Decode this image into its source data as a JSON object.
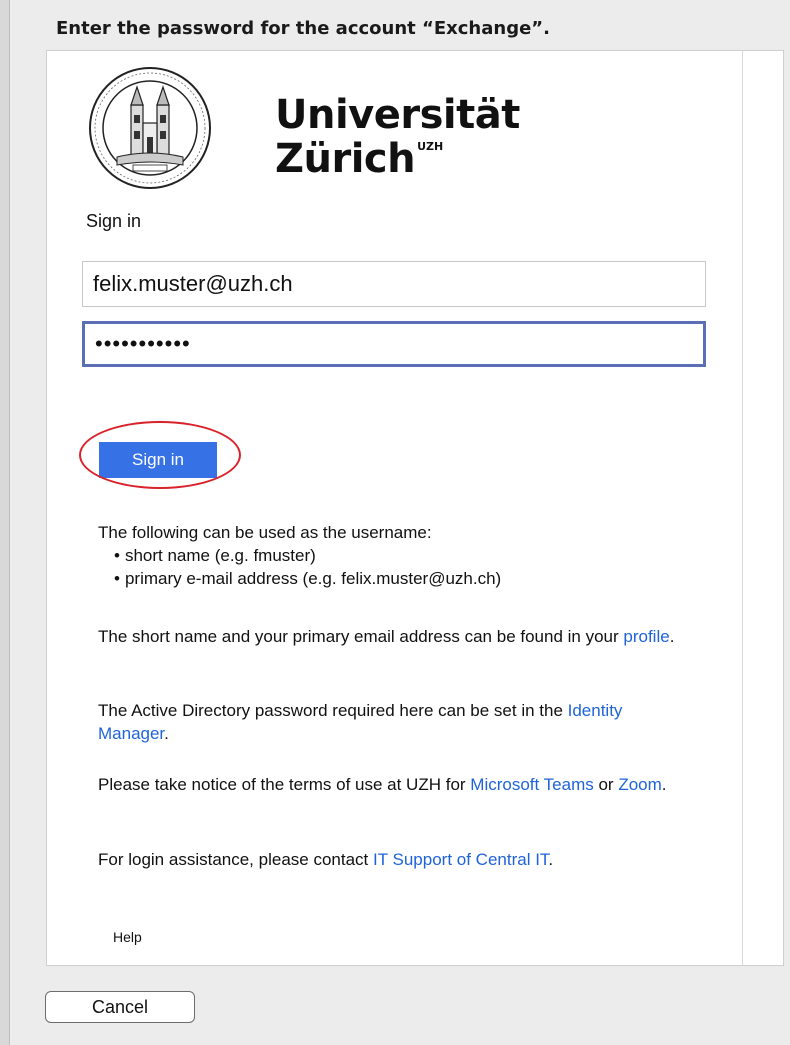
{
  "dialog": {
    "prompt": "Enter the password for the account “Exchange”.",
    "cancel_label": "Cancel"
  },
  "logo": {
    "line1": "Universität",
    "line2": "Zürich",
    "superscript": "UZH",
    "seal": "seal-icon"
  },
  "form": {
    "heading": "Sign in",
    "username_value": "felix.muster@uzh.ch",
    "password_masked": "•••••••••••",
    "submit_label": "Sign in"
  },
  "info": {
    "p1": "The following can be used as the username:",
    "bullets": [
      "short name (e.g. fmuster)",
      "primary e-mail address (e.g. felix.muster@uzh.ch)"
    ],
    "p2_text": "The short name and your primary email address can be found in your ",
    "p2_link": "profile",
    "p2_end": ".",
    "p3_text": "The Active Directory password required here can be set in the ",
    "p3_link": "Identity Manager",
    "p3_end": ".",
    "p4_text": "Please take notice of the terms of use at UZH for ",
    "p4_link1": "Microsoft Teams",
    "p4_mid": " or ",
    "p4_link2": "Zoom",
    "p4_end": ".",
    "p5_text": "For login assistance, please contact ",
    "p5_link": "IT Support of Central IT",
    "p5_end": "."
  },
  "footer": {
    "help_label": "Help"
  },
  "colors": {
    "accent": "#3672e6",
    "link": "#1f63d9",
    "focus_border": "#5a6fb5",
    "annotation": "#d8232a"
  }
}
